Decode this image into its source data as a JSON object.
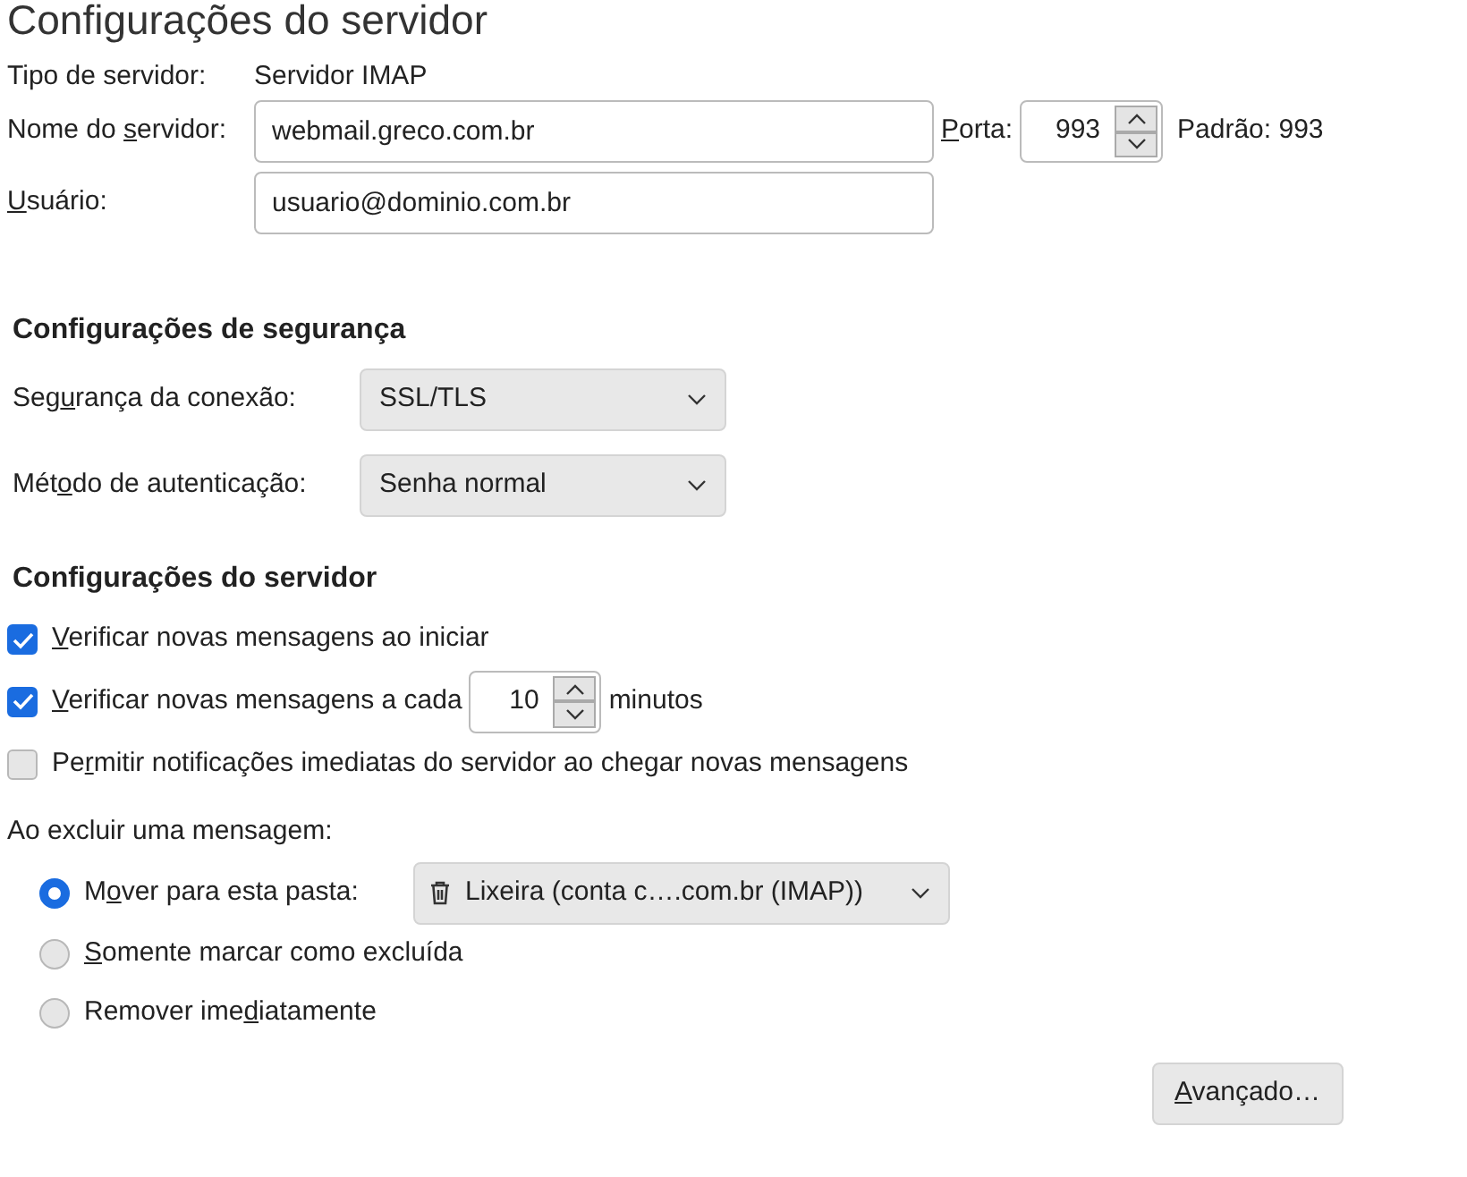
{
  "title": "Configurações do servidor",
  "server": {
    "type_label": "Tipo de servidor:",
    "type_value": "Servidor IMAP",
    "name": {
      "label": [
        {
          "text": "Nome do ",
          "underline": false
        },
        {
          "text": "s",
          "underline": true
        },
        {
          "text": "ervidor:",
          "underline": false
        }
      ],
      "value": "webmail.greco.com.br"
    },
    "port": {
      "label": [
        {
          "text": "P",
          "underline": true
        },
        {
          "text": "orta:",
          "underline": false
        }
      ],
      "value": "993",
      "default": "Padrão: 993"
    },
    "user": {
      "label": [
        {
          "text": "U",
          "underline": true
        },
        {
          "text": "suário:",
          "underline": false
        }
      ],
      "value": "usuario@dominio.com.br"
    }
  },
  "security": {
    "heading": "Configurações de segurança",
    "selects": [
      {
        "label": [
          {
            "text": "Seg",
            "underline": false
          },
          {
            "text": "u",
            "underline": true
          },
          {
            "text": "rança da conexão:",
            "underline": false
          }
        ],
        "value": "SSL/TLS"
      },
      {
        "label": [
          {
            "text": "Mét",
            "underline": false
          },
          {
            "text": "o",
            "underline": true
          },
          {
            "text": "do de autenticação:",
            "underline": false
          }
        ],
        "value": "Senha normal"
      }
    ]
  },
  "server_settings": {
    "heading": "Configurações do servidor",
    "options": [
      {
        "kind": "check",
        "checked": true,
        "label": [
          {
            "text": "V",
            "underline": true
          },
          {
            "text": "erificar novas mensagens ao iniciar",
            "underline": false
          }
        ]
      },
      {
        "kind": "interval",
        "checked": true,
        "label": [
          {
            "text": "V",
            "underline": true
          },
          {
            "text": "erificar novas mensagens a cada",
            "underline": false
          }
        ],
        "value": "10",
        "unit": "minutos"
      },
      {
        "kind": "check",
        "checked": false,
        "label": [
          {
            "text": "Pe",
            "underline": false
          },
          {
            "text": "r",
            "underline": true
          },
          {
            "text": "mitir notificações imediatas do servidor ao chegar novas mensagens",
            "underline": false
          }
        ]
      }
    ],
    "delete": {
      "label": "Ao excluir uma mensagem:",
      "options": [
        {
          "kind": "folder",
          "selected": true,
          "label": [
            {
              "text": "M",
              "underline": false
            },
            {
              "text": "o",
              "underline": true
            },
            {
              "text": "ver para esta pasta:",
              "underline": false
            }
          ],
          "folder": "Lixeira (conta c….com.br (IMAP))"
        },
        {
          "kind": "plain",
          "selected": false,
          "label": [
            {
              "text": "S",
              "underline": true
            },
            {
              "text": "omente marcar como excluída",
              "underline": false
            }
          ]
        },
        {
          "kind": "plain",
          "selected": false,
          "label": [
            {
              "text": "Remover ime",
              "underline": false
            },
            {
              "text": "d",
              "underline": true
            },
            {
              "text": "iatamente",
              "underline": false
            }
          ]
        }
      ]
    }
  },
  "buttons": [
    {
      "label": [
        {
          "text": "A",
          "underline": true
        },
        {
          "text": "vançado…",
          "underline": false
        }
      ]
    }
  ]
}
